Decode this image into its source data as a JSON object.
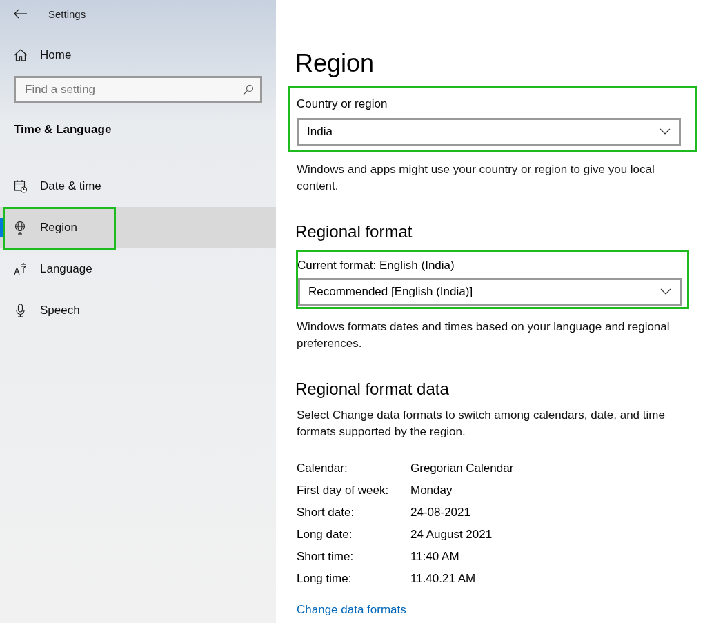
{
  "window": {
    "title": "Settings"
  },
  "sidebar": {
    "home": "Home",
    "search": {
      "placeholder": "Find a setting"
    },
    "section": "Time & Language",
    "items": [
      {
        "label": "Date & time",
        "selected": false,
        "highlighted": false
      },
      {
        "label": "Region",
        "selected": true,
        "highlighted": true
      },
      {
        "label": "Language",
        "selected": false,
        "highlighted": false
      },
      {
        "label": "Speech",
        "selected": false,
        "highlighted": false
      }
    ]
  },
  "page": {
    "title": "Region",
    "country": {
      "label": "Country or region",
      "value": "India",
      "highlighted": true,
      "description": "Windows and apps might use your country or region to give you local content."
    },
    "format": {
      "heading": "Regional format",
      "label": "Current format: English (India)",
      "value": "Recommended [English (India)]",
      "highlighted": true,
      "description": "Windows formats dates and times based on your language and regional preferences."
    },
    "data": {
      "heading": "Regional format data",
      "description": "Select Change data formats to switch among calendars, date, and time formats supported by the region.",
      "rows": [
        {
          "label": "Calendar:",
          "value": "Gregorian Calendar"
        },
        {
          "label": "First day of week:",
          "value": "Monday"
        },
        {
          "label": "Short date:",
          "value": "24-08-2021"
        },
        {
          "label": "Long date:",
          "value": "24 August 2021"
        },
        {
          "label": "Short time:",
          "value": "11:40 AM"
        },
        {
          "label": "Long time:",
          "value": "11.40.21 AM"
        }
      ],
      "link": "Change data formats"
    }
  }
}
